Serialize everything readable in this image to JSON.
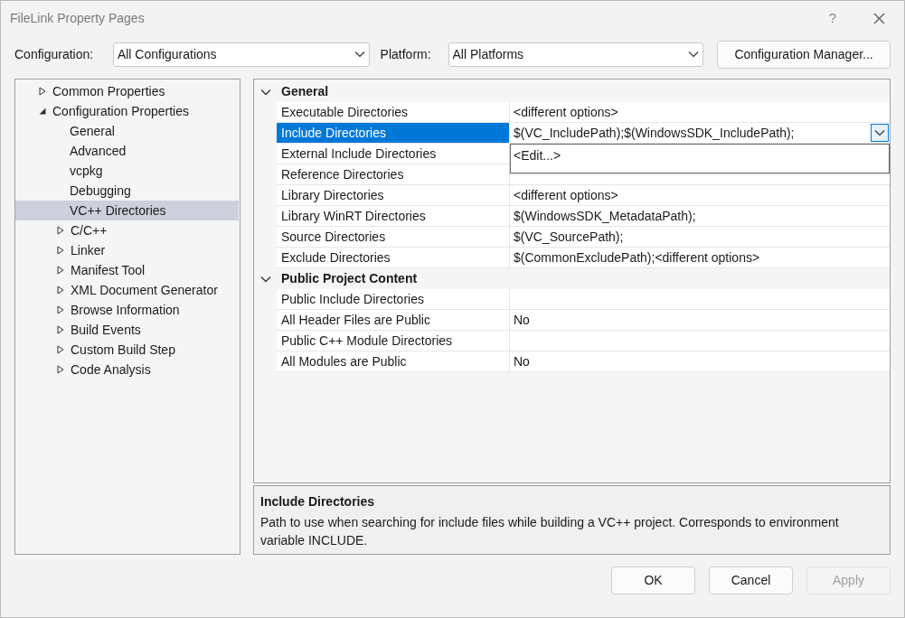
{
  "window": {
    "title": "FileLink Property Pages",
    "help": "?"
  },
  "configuration": {
    "label": "Configuration:",
    "value": "All Configurations"
  },
  "platform": {
    "label": "Platform:",
    "value": "All Platforms"
  },
  "configuration_manager": "Configuration Manager...",
  "tree": [
    {
      "label": "Common Properties",
      "kind": "group",
      "expanded": false,
      "selected": false
    },
    {
      "label": "Configuration Properties",
      "kind": "group",
      "expanded": true,
      "selected": false,
      "children": [
        {
          "label": "General",
          "kind": "leaf",
          "selected": false
        },
        {
          "label": "Advanced",
          "kind": "leaf",
          "selected": false
        },
        {
          "label": "vcpkg",
          "kind": "leaf",
          "selected": false
        },
        {
          "label": "Debugging",
          "kind": "leaf",
          "selected": false
        },
        {
          "label": "VC++ Directories",
          "kind": "leaf",
          "selected": true
        },
        {
          "label": "C/C++",
          "kind": "group",
          "expanded": false,
          "selected": false
        },
        {
          "label": "Linker",
          "kind": "group",
          "expanded": false,
          "selected": false
        },
        {
          "label": "Manifest Tool",
          "kind": "group",
          "expanded": false,
          "selected": false
        },
        {
          "label": "XML Document Generator",
          "kind": "group",
          "expanded": false,
          "selected": false
        },
        {
          "label": "Browse Information",
          "kind": "group",
          "expanded": false,
          "selected": false
        },
        {
          "label": "Build Events",
          "kind": "group",
          "expanded": false,
          "selected": false
        },
        {
          "label": "Custom Build Step",
          "kind": "group",
          "expanded": false,
          "selected": false
        },
        {
          "label": "Code Analysis",
          "kind": "group",
          "expanded": false,
          "selected": false
        }
      ]
    }
  ],
  "properties": [
    {
      "category": "General",
      "expanded": true,
      "rows": [
        {
          "name": "Executable Directories",
          "value": "<different options>",
          "selected": false
        },
        {
          "name": "Include Directories",
          "value": "$(VC_IncludePath);$(WindowsSDK_IncludePath);",
          "selected": true,
          "popup": [
            "<Edit...>"
          ]
        },
        {
          "name": "External Include Directories",
          "selected": false
        },
        {
          "name": "Reference Directories",
          "selected": false
        },
        {
          "name": "Library Directories",
          "value": "<different options>",
          "selected": false
        },
        {
          "name": "Library WinRT Directories",
          "value": "$(WindowsSDK_MetadataPath);",
          "selected": false
        },
        {
          "name": "Source Directories",
          "value": "$(VC_SourcePath);",
          "selected": false
        },
        {
          "name": "Exclude Directories",
          "value": "$(CommonExcludePath);<different options>",
          "selected": false
        }
      ]
    },
    {
      "category": "Public Project Content",
      "expanded": true,
      "rows": [
        {
          "name": "Public Include Directories",
          "selected": false
        },
        {
          "name": "All Header Files are Public",
          "value": "No",
          "selected": false
        },
        {
          "name": "Public C++ Module Directories",
          "selected": false
        },
        {
          "name": "All Modules are Public",
          "value": "No",
          "selected": false
        }
      ]
    }
  ],
  "description": {
    "title": "Include Directories",
    "text": "Path to use when searching for include files while building a VC++ project.  Corresponds to environment variable INCLUDE."
  },
  "buttons": [
    {
      "label": "OK",
      "disabled": false
    },
    {
      "label": "Cancel",
      "disabled": false
    },
    {
      "label": "Apply",
      "disabled": true
    }
  ]
}
